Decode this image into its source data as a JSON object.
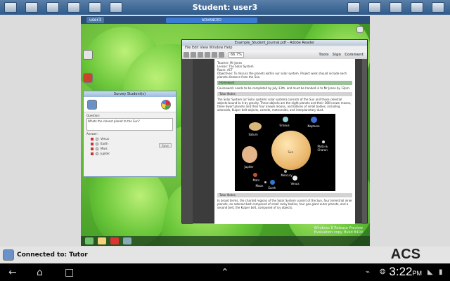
{
  "topbar": {
    "title": "Student: user3",
    "left_icons": [
      "home-icon",
      "globe-icon",
      "monitor-icon",
      "folder-icon",
      "users-icon",
      "printer-icon"
    ],
    "right_icons": [
      "user-icon",
      "grid-icon",
      "calendar-icon",
      "gear-icon",
      "more-icon"
    ]
  },
  "remote": {
    "tab_label": "user3",
    "connection_bar": "ADVANCED",
    "reader": {
      "title": "Example_Student_Journal.pdf - Adobe Reader",
      "menu": "File Edit View Window Help",
      "zoom": "66.7%",
      "tools_label": "Tools",
      "sign_label": "Sign",
      "comment_label": "Comment",
      "lines": [
        "Teacher: Mr Jones",
        "Lesson: The Solar System",
        "Room: ACT",
        "Objectives: To discuss the planets within our solar system. Project work should include each planets distance from the Sun."
      ],
      "section1": "Homework",
      "section1_text": "Coursework needs to be completed by July 13th, and must be handed in to Mr Jones by 12pm.",
      "section2": "Tutor Notes",
      "section2_text": "The Solar System (or Solar system) solar system) consists of the Sun and those celestial objects bound to it by gravity. These objects are the eight planets and their 166 known moons, three dwarf planets and their four known moons, and billions of small bodies, including asteroids, Kuiper belt objects, comets, meteoroids, and interplanetary dust.",
      "section3": "Tutor Notes",
      "section3_text": "In broad terms, the charted regions of the Solar System consist of the Sun, four terrestrial inner planets, an asteroid belt composed of small rocky bodies, four gas giant outer planets, and a second belt, the Kuiper belt, composed of icy objects.",
      "solar_labels": {
        "saturn": "Saturn",
        "uranus": "Uranus",
        "neptune": "Neptune",
        "jupiter": "Jupiter",
        "sun": "Sun",
        "pluto": "Pluto & Charon",
        "mars": "Mars",
        "mercury": "Mercury",
        "venus": "Venus",
        "moon": "Moon",
        "earth": "Earth"
      }
    },
    "survey": {
      "title": "Survey Student(s)",
      "question_label": "Question:",
      "question": "Whats the closest planet to the Sun?",
      "answer_label": "Answer:",
      "answers": [
        "Venus",
        "Earth",
        "Mars",
        "Jupiter"
      ],
      "button": "Save"
    },
    "watermark": [
      "Windows 8 Release Preview",
      "Evaluation copy. Build 8400"
    ]
  },
  "status": {
    "text": "Connected to: Tutor",
    "brand": "ACS"
  },
  "navbar": {
    "time": "3:22",
    "ampm": "PM"
  }
}
